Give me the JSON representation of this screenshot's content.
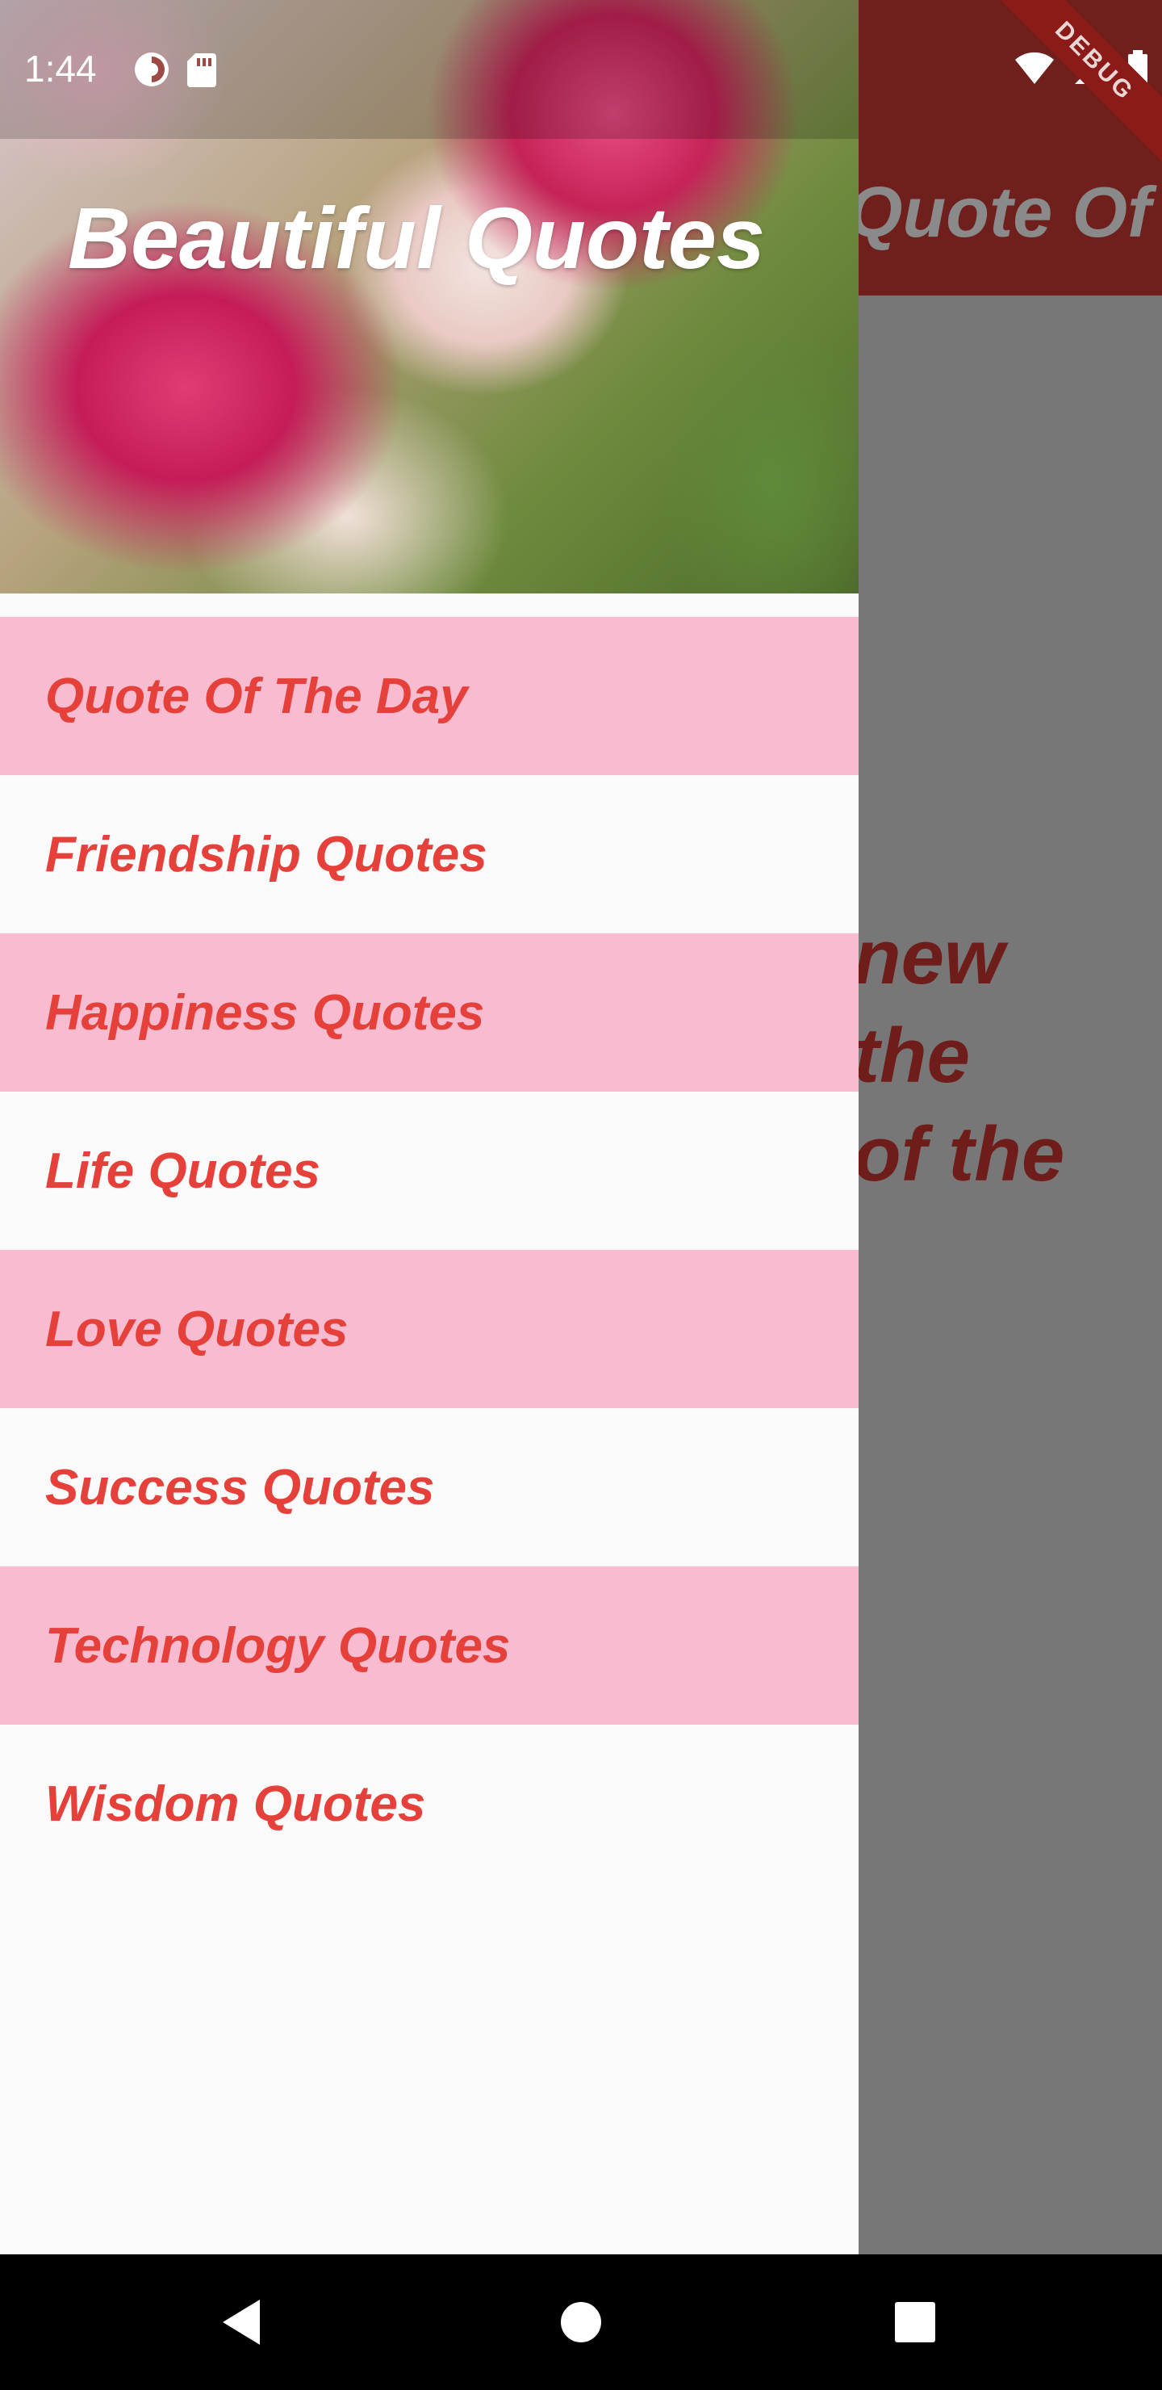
{
  "status_bar": {
    "time": "1:44",
    "left_icons": [
      "data-saver-icon",
      "sd-card-icon"
    ],
    "right_icons": [
      "wifi-icon",
      "cell-signal-icon",
      "battery-icon"
    ],
    "debug_label": "DEBUG"
  },
  "background_page": {
    "app_bar_title": "Quote Of The Day",
    "quote_lines": [
      "new",
      "the",
      "of the"
    ],
    "colors": {
      "app_bar": "#6f201c",
      "scrim": "#777777",
      "quote_text": "#6f1d1a"
    }
  },
  "drawer": {
    "header_title": "Beautiful Quotes",
    "header_image": "pink-roses-photo",
    "items": [
      {
        "label": "Quote Of The Day"
      },
      {
        "label": "Friendship Quotes"
      },
      {
        "label": "Happiness Quotes"
      },
      {
        "label": "Life Quotes"
      },
      {
        "label": "Love Quotes"
      },
      {
        "label": "Success Quotes"
      },
      {
        "label": "Technology Quotes"
      },
      {
        "label": "Wisdom Quotes"
      }
    ],
    "colors": {
      "item_text": "#e5413a",
      "item_pink": "#f8bbd0",
      "item_white": "#fafafa"
    }
  },
  "nav_bar": {
    "buttons": [
      "back-icon",
      "home-icon",
      "recents-icon"
    ]
  }
}
